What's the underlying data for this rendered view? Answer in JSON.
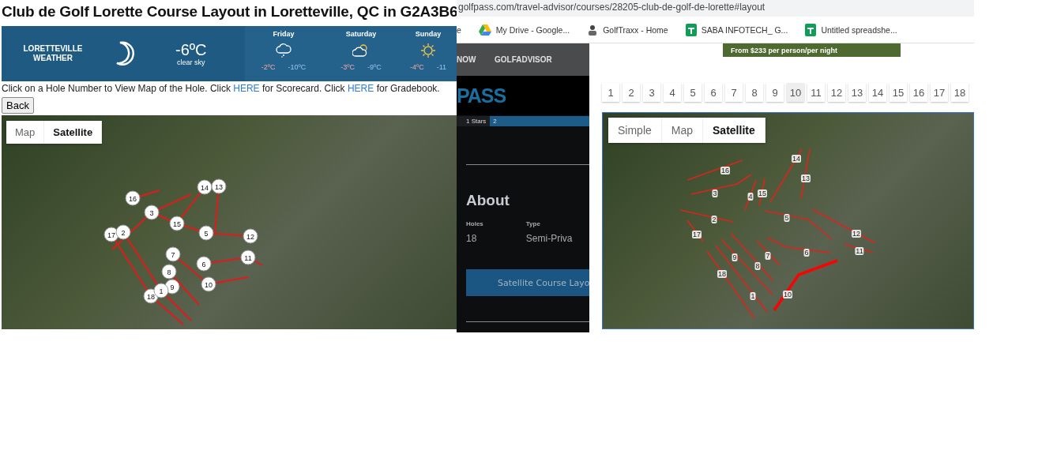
{
  "left_page": {
    "title": "Club de Golf Lorette Course Layout in Loretteville, QC in G2A3B6",
    "weather": {
      "location": "LORETTEVILLE",
      "label": "WEATHER",
      "temperature": "-6ºC",
      "condition": "clear sky",
      "forecast": [
        {
          "day": "Friday",
          "kind": "snow",
          "high": "-2ºC",
          "low": "-10ºC"
        },
        {
          "day": "Saturday",
          "kind": "partly-cloudy",
          "high": "-3ºC",
          "low": "-9ºC"
        },
        {
          "day": "Sunday",
          "kind": "sunny",
          "high": "-4ºC",
          "low": "-11"
        }
      ]
    },
    "instructions": [
      {
        "kind": "text",
        "text": "Click on a Hole Number to View Map of the Hole. Click "
      },
      {
        "kind": "link",
        "text": "HERE"
      },
      {
        "kind": "text",
        "text": " for Scorecard. Click "
      },
      {
        "kind": "link",
        "text": "HERE"
      },
      {
        "kind": "text",
        "text": " for Gradebook."
      }
    ],
    "back_button": "Back",
    "map": {
      "types": [
        {
          "label": "Map",
          "selected": false
        },
        {
          "label": "Satellite",
          "selected": true
        }
      ],
      "hole_markers": [
        "14",
        "13",
        "16",
        "3",
        "15",
        "17",
        "2",
        "5",
        "12",
        "7",
        "11",
        "6",
        "8",
        "9",
        "10",
        "18",
        "1"
      ]
    }
  },
  "browser": {
    "address": "golfpass.com/travel-advisor/courses/28205-club-de-golf-de-lorette#layout",
    "bookmarks": [
      {
        "kind": "cut",
        "label": "e"
      },
      {
        "kind": "drive",
        "label": "My Drive - Google..."
      },
      {
        "kind": "person",
        "label": "GolfTraxx - Home"
      },
      {
        "kind": "sheet",
        "label": "SABA INFOTECH_ G..."
      },
      {
        "kind": "sheet",
        "label": "Untitled spreadshe..."
      }
    ]
  },
  "golfpass": {
    "nav": [
      "NOW",
      "GOLFADVISOR"
    ],
    "logo": "PASS",
    "rating": [
      {
        "label": "1 Stars",
        "selected": false
      },
      {
        "label": "2",
        "selected": true
      }
    ],
    "about_title": "About",
    "facts": [
      {
        "label": "Holes",
        "value": "18"
      },
      {
        "label": "Type",
        "value": "Semi-Priva"
      }
    ],
    "layout_button": "Satellite Course Layo"
  },
  "layout_page": {
    "ad": "From $233 per person/per night",
    "hole_tabs": [
      {
        "label": "1",
        "selected": false
      },
      {
        "label": "2",
        "selected": false
      },
      {
        "label": "3",
        "selected": false
      },
      {
        "label": "4",
        "selected": false
      },
      {
        "label": "5",
        "selected": false
      },
      {
        "label": "6",
        "selected": false
      },
      {
        "label": "7",
        "selected": false
      },
      {
        "label": "8",
        "selected": false
      },
      {
        "label": "9",
        "selected": false
      },
      {
        "label": "10",
        "selected": true
      },
      {
        "label": "11",
        "selected": false
      },
      {
        "label": "12",
        "selected": false
      },
      {
        "label": "13",
        "selected": false
      },
      {
        "label": "14",
        "selected": false
      },
      {
        "label": "15",
        "selected": false
      },
      {
        "label": "16",
        "selected": false
      },
      {
        "label": "17",
        "selected": false
      },
      {
        "label": "18",
        "selected": false
      }
    ],
    "map": {
      "types": [
        {
          "label": "Simple",
          "selected": false
        },
        {
          "label": "Map",
          "selected": false
        },
        {
          "label": "Satellite",
          "selected": true
        }
      ],
      "hole_labels": [
        "16",
        "14",
        "13",
        "3",
        "4",
        "15",
        "2",
        "5",
        "17",
        "12",
        "11",
        "7",
        "6",
        "9",
        "8",
        "18",
        "1",
        "10"
      ]
    }
  }
}
